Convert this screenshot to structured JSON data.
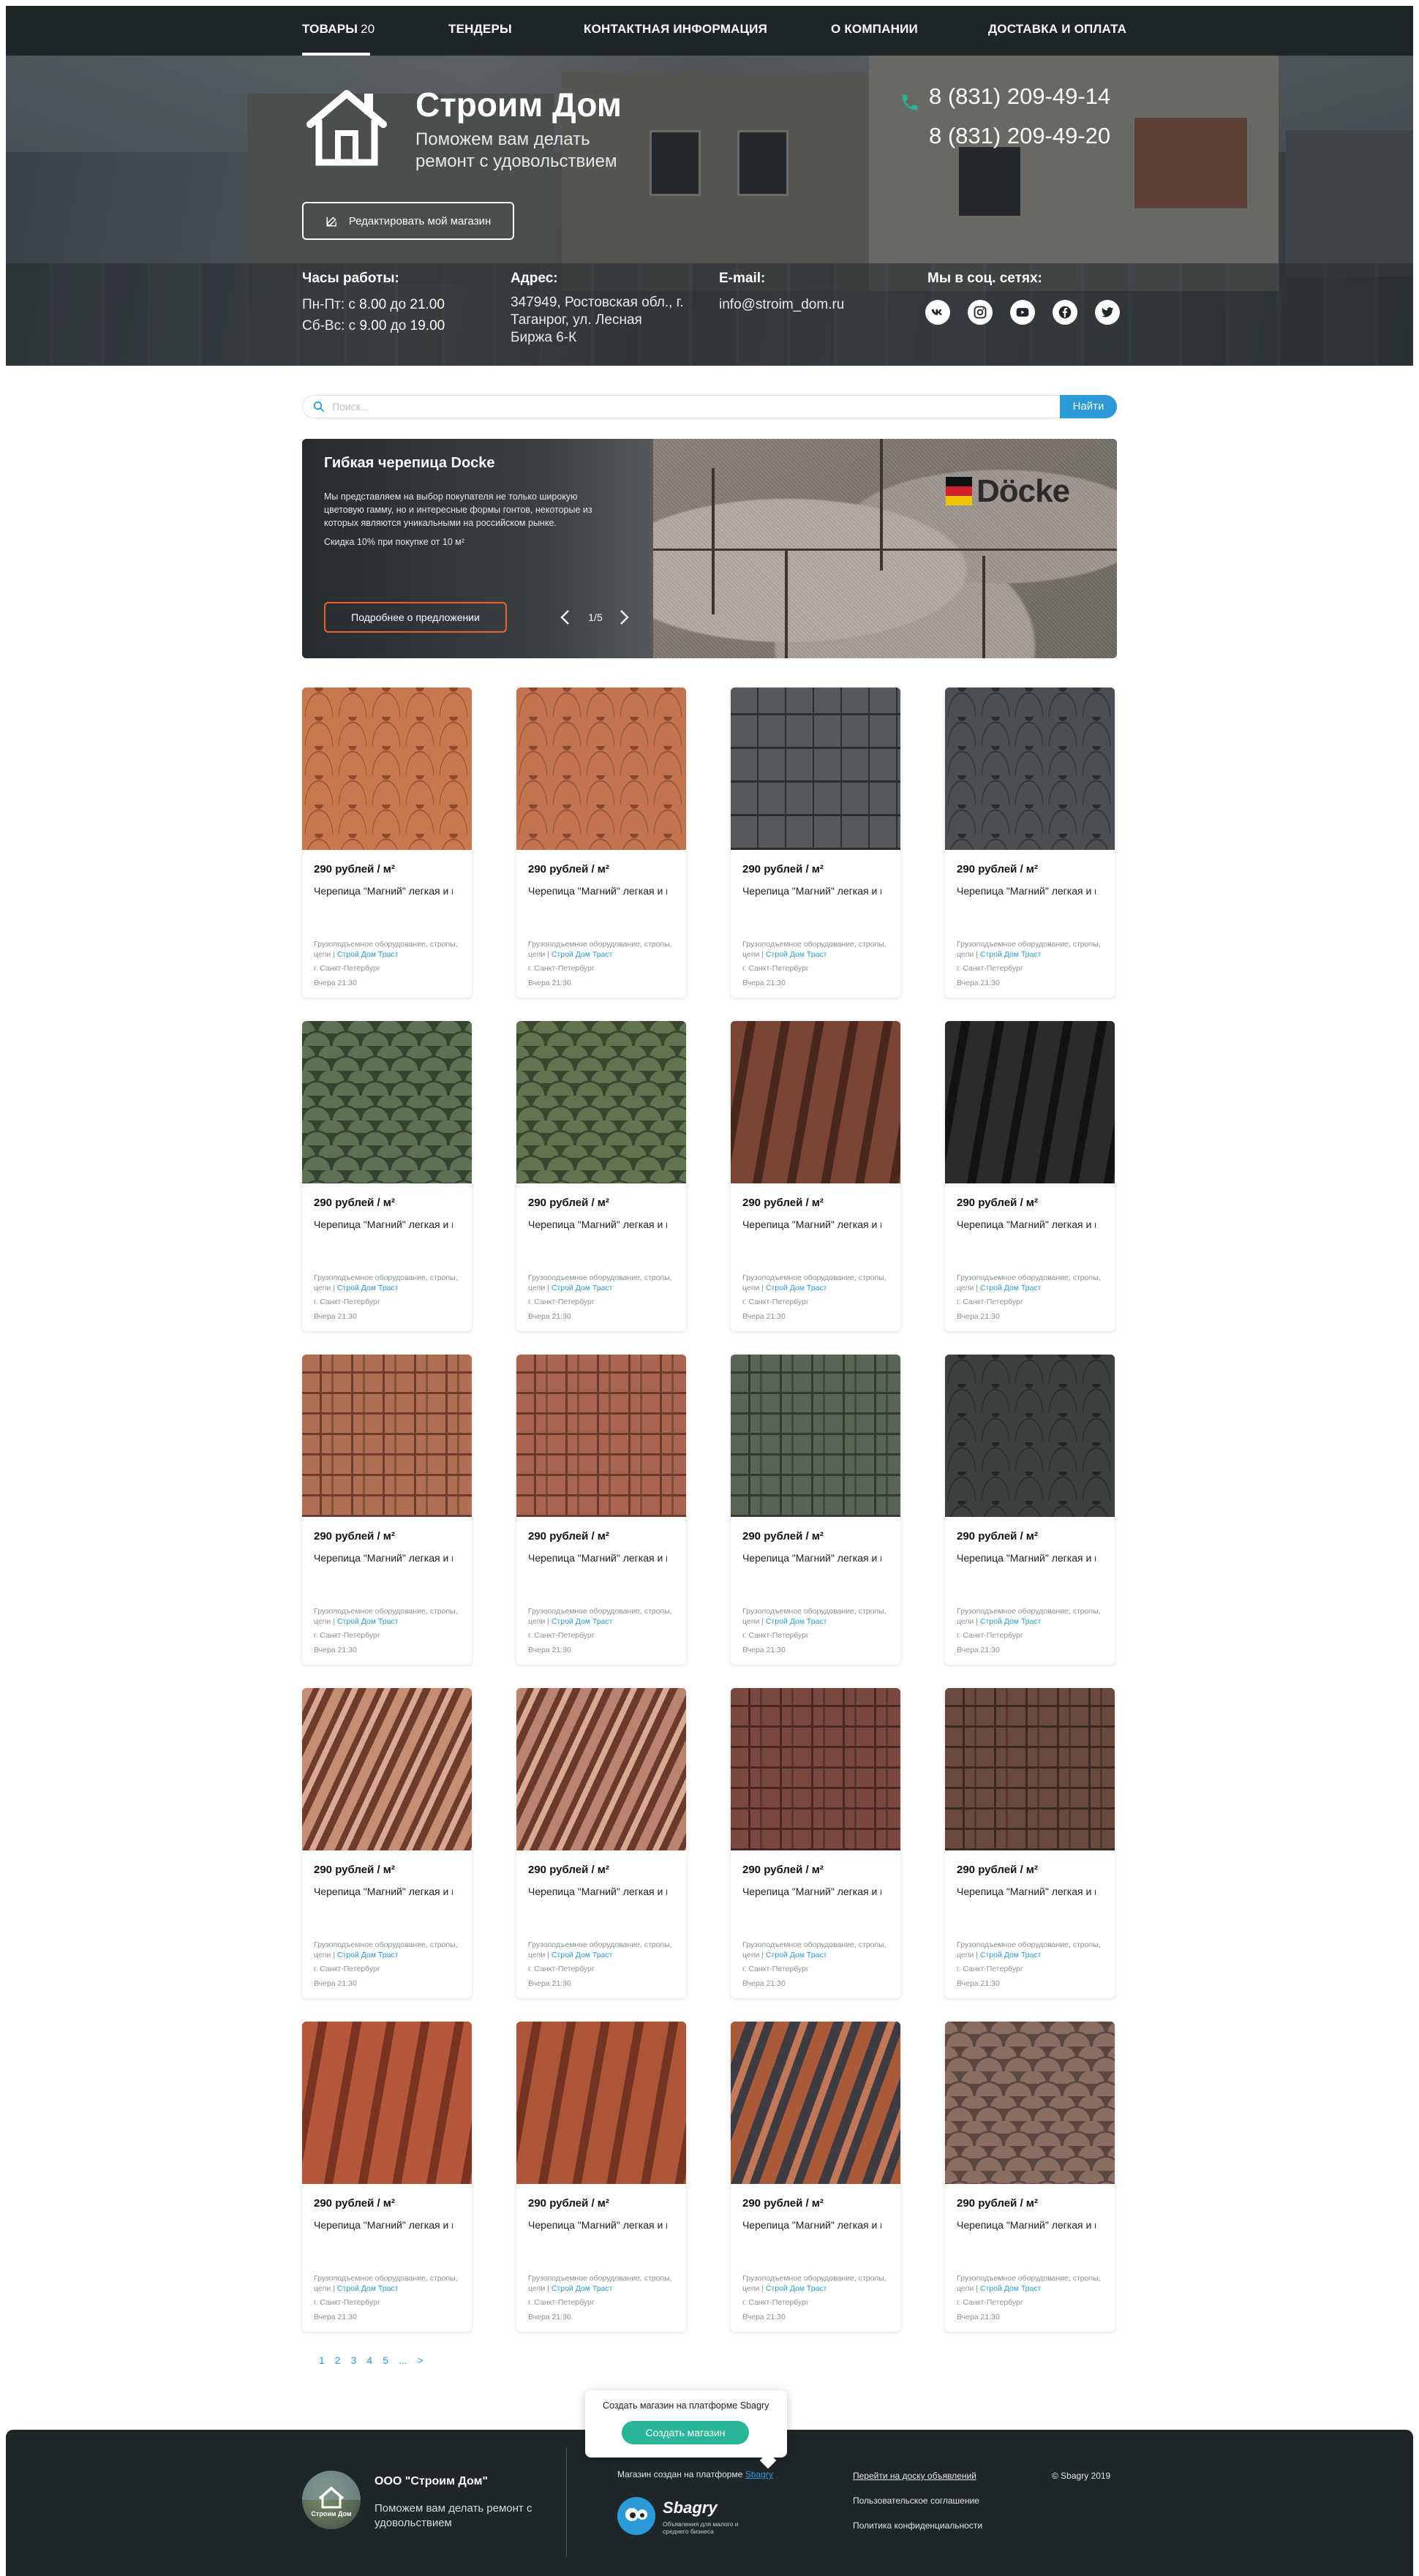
{
  "nav": {
    "items": [
      {
        "label": "ТОВАРЫ",
        "count": "20"
      },
      {
        "label": "ТЕНДЕРЫ"
      },
      {
        "label": "КОНТАКТНАЯ ИНФОРМАЦИЯ"
      },
      {
        "label": "О КОМПАНИИ"
      },
      {
        "label": "ДОСТАВКА И ОПЛАТА"
      }
    ]
  },
  "brand": {
    "title": "Строим Дом",
    "subtitle": "Поможем вам делать ремонт с удовольствием"
  },
  "phones": [
    "8 (831) 209-49-14",
    "8 (831) 209-49-20"
  ],
  "edit_button": "Редактировать мой магазин",
  "info": {
    "hours_title": "Часы работы:",
    "hours": [
      {
        "label": "Пн-Пт: с ",
        "from": "8.00",
        "mid": " до ",
        "to": "21.00"
      },
      {
        "label": "Сб-Вс: с ",
        "from": "9.00",
        "mid": " до ",
        "to": "19.00"
      }
    ],
    "address_title": "Адрес:",
    "address": "347949, Ростовская обл., г. Таганрог, ул. Лесная Биржа 6-К",
    "email_title": "E-mail:",
    "email": "info@stroim_dom.ru",
    "social_title": "Мы в соц. сетях:",
    "social_icons": [
      "vk-icon",
      "instagram-icon",
      "youtube-icon",
      "facebook-icon",
      "twitter-icon"
    ]
  },
  "search": {
    "placeholder": "Поиск...",
    "button": "Найти"
  },
  "banner": {
    "title": "Гибкая черепица Docke",
    "text": "Мы представляем на выбор покупателя не только широкую цветовую гамму, но и интересные формы гонтов, некоторые из которых являются уникальными на российском рынке.",
    "discount": "Скидка 10% при покупке от 10 м²",
    "button": "Подробнее о предложении",
    "counter": "1/5",
    "logo_text": "Döcke"
  },
  "card_template": {
    "price": "290 рублей / м²",
    "name": "Черепица \"Магний\" легкая и прочная если за",
    "category": "Грузоподъемное оборудование, стропы, цепи | ",
    "seller": "Строй Дом Траст",
    "city": "г. Санкт-Петербург",
    "time": "Вчера 21:30"
  },
  "cards": [
    {
      "color_a": "#c8784f",
      "color_b": "#8c4a2e",
      "pattern": "hex"
    },
    {
      "color_a": "#c27450",
      "color_b": "#884630",
      "pattern": "hex"
    },
    {
      "color_a": "#55585c",
      "color_b": "#2b2e31",
      "pattern": "shake"
    },
    {
      "color_a": "#4b4e52",
      "color_b": "#2a2c2f",
      "pattern": "hex"
    },
    {
      "color_a": "#5d7254",
      "color_b": "#34432f",
      "pattern": "scale"
    },
    {
      "color_a": "#61734f",
      "color_b": "#38452f",
      "pattern": "scale"
    },
    {
      "color_a": "#7a4535",
      "color_b": "#4a271d",
      "pattern": "tile"
    },
    {
      "color_a": "#2b2b2d",
      "color_b": "#121213",
      "pattern": "tile"
    },
    {
      "color_a": "#b06f53",
      "color_b": "#6d3d2b",
      "pattern": "brick"
    },
    {
      "color_a": "#a9654f",
      "color_b": "#6a3a2c",
      "pattern": "brick"
    },
    {
      "color_a": "#5a6653",
      "color_b": "#333b30",
      "pattern": "brick"
    },
    {
      "color_a": "#3c413e",
      "color_b": "#222524",
      "pattern": "hex"
    },
    {
      "color_a": "#c58e73",
      "color_b": "#6e3c2c",
      "pattern": "stripe"
    },
    {
      "color_a": "#b98370",
      "color_b": "#6a3b2c",
      "pattern": "stripe"
    },
    {
      "color_a": "#7a4840",
      "color_b": "#4a2722",
      "pattern": "brick"
    },
    {
      "color_a": "#6a4a3f",
      "color_b": "#3c2922",
      "pattern": "brick"
    },
    {
      "color_a": "#b5573a",
      "color_b": "#7a3320",
      "pattern": "tile"
    },
    {
      "color_a": "#ad5538",
      "color_b": "#733321",
      "pattern": "tile"
    },
    {
      "color_a": "#a85a3a",
      "color_b": "#3e3c42",
      "pattern": "mix"
    },
    {
      "color_a": "#8a6e63",
      "color_b": "#5a463e",
      "pattern": "scale"
    }
  ],
  "pagination": [
    "1",
    "2",
    "3",
    "4",
    "5",
    "...",
    ">"
  ],
  "popup": {
    "text": "Создать магазин на платформе Sbagry",
    "button": "Создать магазин"
  },
  "footer": {
    "company": "ООО \"Строим Дом\"",
    "slogan": "Поможем вам делать ремонт с удовольствием",
    "logo_text": "Строим Дом",
    "made_on": "Магазин создан на платформе ",
    "made_link": "Sbagry",
    "sbagry_word": "Sbagry",
    "sbagry_sub": "Объявления для малого и среднего бизнеса",
    "links": [
      "Перейти на доску объявлений",
      "Пользовательское соглашение",
      "Политика конфиденциальности"
    ],
    "copyright": "© Sbagry 2019"
  },
  "colors": {
    "nav_bg": "#1f2629",
    "accent_blue": "#2d9ad8",
    "accent_orange": "#e6622c",
    "accent_green": "#2ab598",
    "phone_icon": "#2ab598"
  }
}
